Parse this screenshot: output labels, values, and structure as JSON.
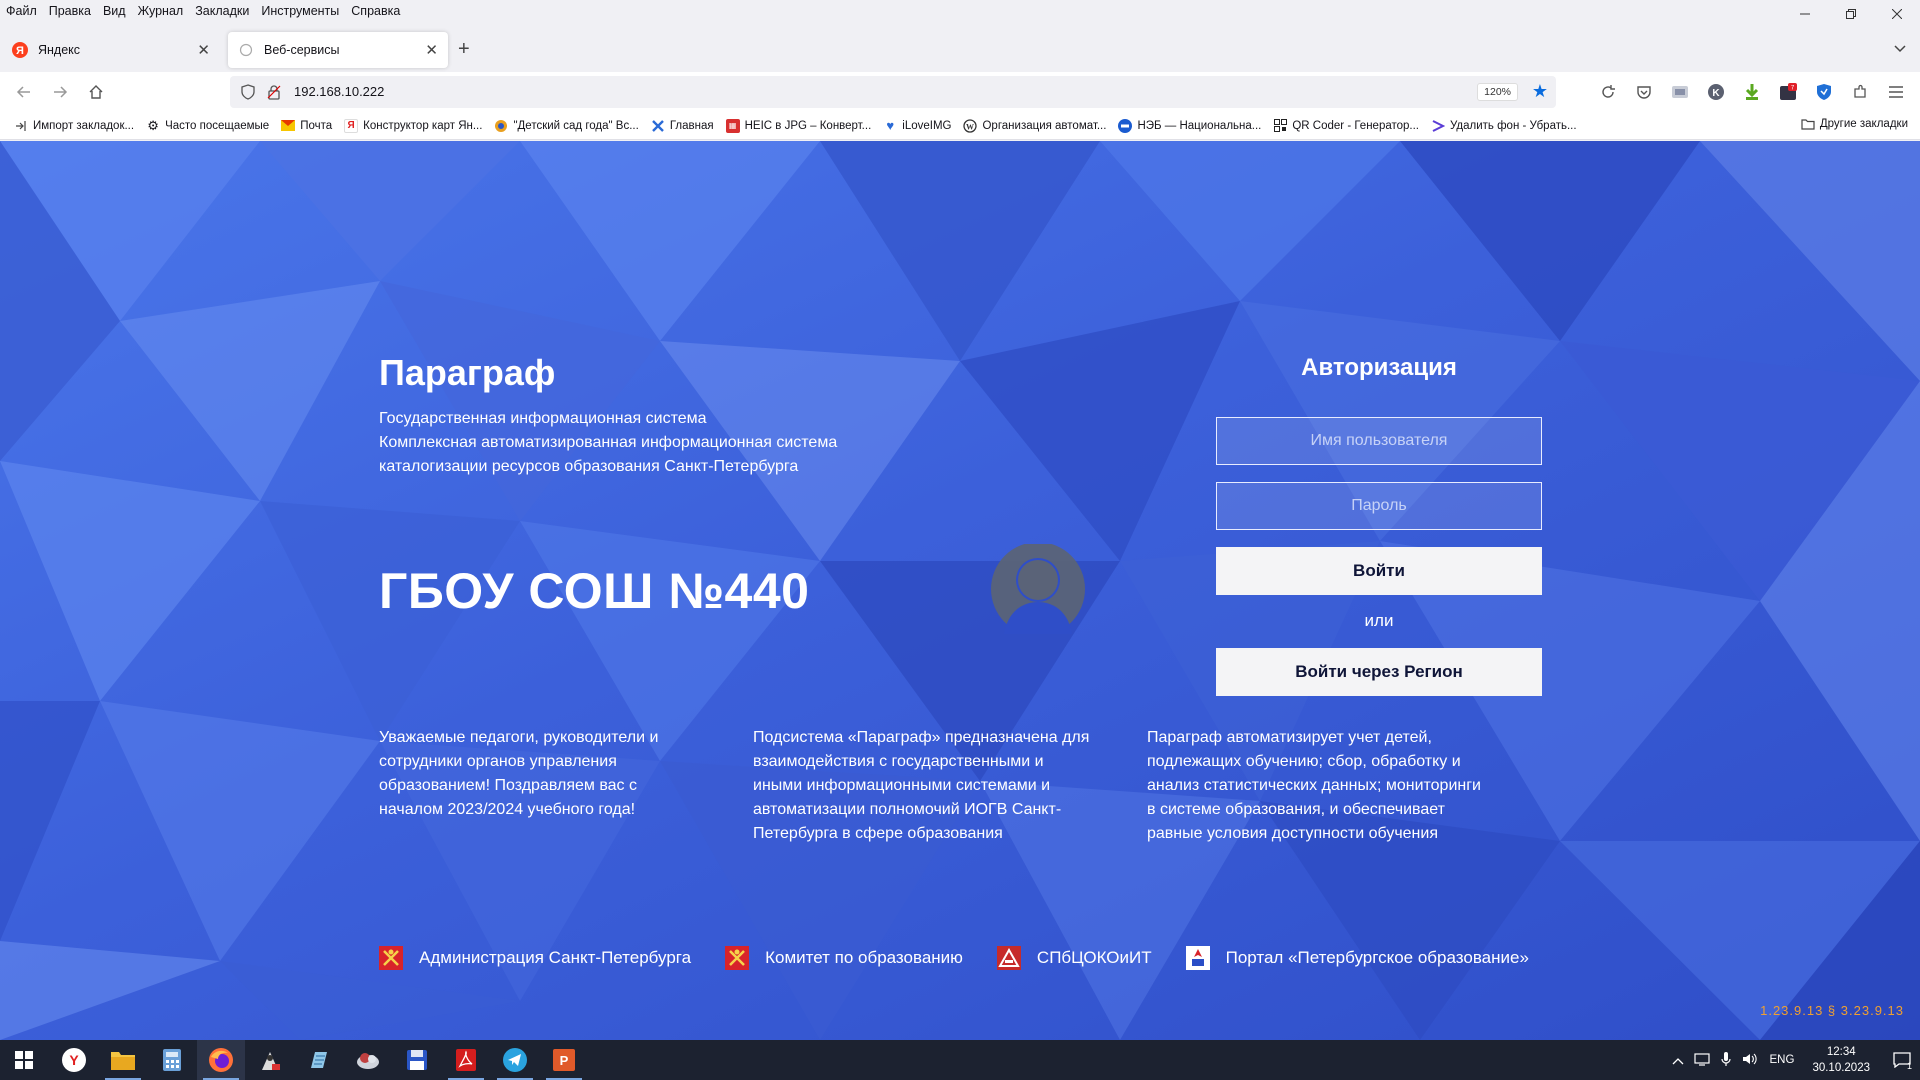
{
  "browser": {
    "menu": [
      "Файл",
      "Правка",
      "Вид",
      "Журнал",
      "Закладки",
      "Инструменты",
      "Справка"
    ],
    "tabs": [
      {
        "title": "Яндекс",
        "active": false
      },
      {
        "title": "Веб-сервисы",
        "active": true
      }
    ],
    "url": "192.168.10.222",
    "zoom": "120%",
    "bookmarks": [
      {
        "label": "Импорт закладок...",
        "icon": "import-icon"
      },
      {
        "label": "Часто посещаемые",
        "icon": "gear-icon"
      },
      {
        "label": "Почта",
        "icon": "mail-icon"
      },
      {
        "label": "Конструктор карт Ян...",
        "icon": "yandex-icon"
      },
      {
        "label": "\"Детский сад года\" Вс...",
        "icon": "circle-icon"
      },
      {
        "label": "Главная",
        "icon": "cross-icon"
      },
      {
        "label": "HEIC в JPG – Конверт...",
        "icon": "grid-icon"
      },
      {
        "label": "iLoveIMG",
        "icon": "heart-icon"
      },
      {
        "label": "Организация автомат...",
        "icon": "wordpress-icon"
      },
      {
        "label": "НЭБ — Национальна...",
        "icon": "neb-icon"
      },
      {
        "label": "QR Coder - Генератор...",
        "icon": "qr-icon"
      },
      {
        "label": "Удалить фон - Убрать...",
        "icon": "scissors-icon"
      }
    ],
    "other_bookmarks": "Другие закладки"
  },
  "page": {
    "brand_title": "Параграф",
    "brand_sub": [
      "Государственная информационная система",
      "Комплексная автоматизированная информационная система",
      "каталогизации ресурсов образования Санкт-Петербурга"
    ],
    "school": "ГБОУ СОШ №440",
    "auth": {
      "title": "Авторизация",
      "username_placeholder": "Имя пользователя",
      "password_placeholder": "Пароль",
      "login_button": "Войти",
      "or": "или",
      "region_button": "Войти через Регион"
    },
    "info": [
      [
        "Уважаемые педагоги, руководители и",
        "сотрудники органов управления",
        "образованием! Поздравляем вас с",
        "началом 2023/2024 учебного года!"
      ],
      [
        "Подсистема «Параграф» предназначена для",
        "взаимодействия с государственными и",
        "иными информационными системами и",
        "автоматизации полномочий ИОГВ Санкт-",
        "Петербурга в сфере образования"
      ],
      [
        "Параграф автоматизирует учет детей,",
        "подлежащих обучению; сбор, обработку и",
        "анализ статистических данных; мониторинги",
        "в системе образования, и обеспечивает",
        "равные условия доступности обучения"
      ]
    ],
    "footer_links": [
      {
        "label": "Администрация Санкт-Петербурга"
      },
      {
        "label": "Комитет по образованию"
      },
      {
        "label": "СПбЦОКОиИТ"
      },
      {
        "label": "Портал «Петербургское образование»"
      }
    ],
    "version": "1.23.9.13 § 3.23.9.13"
  },
  "taskbar": {
    "lang": "ENG",
    "time": "12:34",
    "date": "30.10.2023",
    "notifications": "1"
  }
}
